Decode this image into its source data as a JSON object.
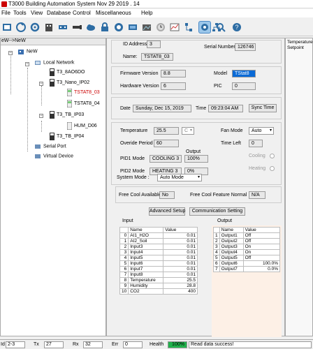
{
  "window": {
    "title": "T3000 Building Automation System    Nov 29 2019 . 14"
  },
  "menu": [
    "File",
    "Tools",
    "View",
    "Database",
    "Control",
    "Miscellaneous",
    "Help"
  ],
  "toolbar": {
    "icons": [
      "connect-icon",
      "scan-icon",
      "refresh-icon",
      "building-icon",
      "network-icon",
      "usb-icon",
      "cloud-icon",
      "lock-icon",
      "inputs-icon",
      "outputs-icon",
      "graphic-icon",
      "alarm-icon",
      "chart-icon",
      "config-icon",
      "screen-icon",
      "tree-icon",
      "settings-icon",
      "search-icon",
      "help-icon"
    ]
  },
  "tree": {
    "header": "eW-->NeW",
    "root": "NeW",
    "local_network": "Local Network",
    "items": [
      "T3_8AO6DO",
      "T3_Nano_IP02",
      "TSTAT8_03",
      "TSTAT8_04",
      "T3_TB_IP03",
      "HUM_D06",
      "T3_TB_IP04"
    ],
    "serial_port": "Serial Port",
    "virtual_device": "Virtual Device"
  },
  "device": {
    "id_label": "ID Address",
    "id_value": "3",
    "serial_label": "Serial Number",
    "serial_value": "126746",
    "name_label": "Name:",
    "name_value": "TSTAT8_03",
    "fw_label": "Firmware Version",
    "fw_value": "8.8",
    "hw_label": "Hardware Version",
    "hw_value": "6",
    "model_label": "Model",
    "model_value": "TStat8",
    "pic_label": "PIC",
    "pic_value": "0",
    "date_label": "Date",
    "date_value": "Sunday, Dec 15, 2019",
    "time_label": "Time",
    "time_value": "09:23:04 AM",
    "sync_label": "Sync Time"
  },
  "control": {
    "temp_label": "Temperature",
    "temp_value": "25.5",
    "temp_unit": "C",
    "override_label": "Overide Period",
    "override_value": "60",
    "output_label": "Output",
    "pid1_label": "PID1 Mode",
    "pid1_mode": "COOLING 3",
    "pid1_output": "100%",
    "pid2_label": "PID2 Mode",
    "pid2_mode": "HEATING 3",
    "pid2_output": "0%",
    "fan_label": "Fan Mode",
    "fan_value": "Auto",
    "timeleft_label": "Time Left",
    "timeleft_value": "0",
    "cooling_label": "Cooling",
    "heating_label": "Heating",
    "sysmode_label": "System Mode :",
    "sysmode_value": "Auto Mode"
  },
  "freecool": {
    "avail_label": "Free Cool Available",
    "avail_value": "No",
    "feature_label": "Free Cool Feature Normal",
    "feature_value": "N/A",
    "advanced_button": "Advanced Setup",
    "comm_button": "Communication Setting"
  },
  "input": {
    "title": "Input",
    "headers": [
      "Name",
      "Value"
    ],
    "rows": [
      [
        "0",
        "AI1_H2O",
        "0.01"
      ],
      [
        "1",
        "AI2_Soil",
        "0.01"
      ],
      [
        "2",
        "Input3",
        "0.01"
      ],
      [
        "3",
        "Input4",
        "0.01"
      ],
      [
        "4",
        "Input5",
        "0.01"
      ],
      [
        "5",
        "Input6",
        "0.01"
      ],
      [
        "6",
        "Input7",
        "0.01"
      ],
      [
        "7",
        "Input8",
        "0.01"
      ],
      [
        "8",
        "Temperature",
        "25.5"
      ],
      [
        "9",
        "Humidity",
        "28.8"
      ],
      [
        "10",
        "CO2",
        "400"
      ]
    ]
  },
  "output": {
    "title": "Output",
    "headers": [
      "Name",
      "Value"
    ],
    "rows": [
      [
        "1",
        "Output1",
        "Off"
      ],
      [
        "2",
        "Output2",
        "Off"
      ],
      [
        "3",
        "Output3",
        "On"
      ],
      [
        "4",
        "Output4",
        "On"
      ],
      [
        "5",
        "Output5",
        "Off"
      ],
      [
        "6",
        "Output6",
        "100.0%"
      ],
      [
        "7",
        "Output7",
        "0.0%"
      ]
    ]
  },
  "side_panel": {
    "title": "Temperature Setpoint"
  },
  "status": {
    "id_label": "Id",
    "id_value": "2-3",
    "tx_label": "Tx",
    "tx_value": "27",
    "rx_label": "Rx",
    "rx_value": "32",
    "err_label": "Err",
    "err_value": "0",
    "health_label": "Health",
    "health_value": "100%",
    "message": "Read data success!"
  },
  "colors": {
    "accent": "#0a6ad6",
    "health": "#22b14c",
    "selected_tree": "#cc0000",
    "output_panel": "#fdf0e6"
  }
}
